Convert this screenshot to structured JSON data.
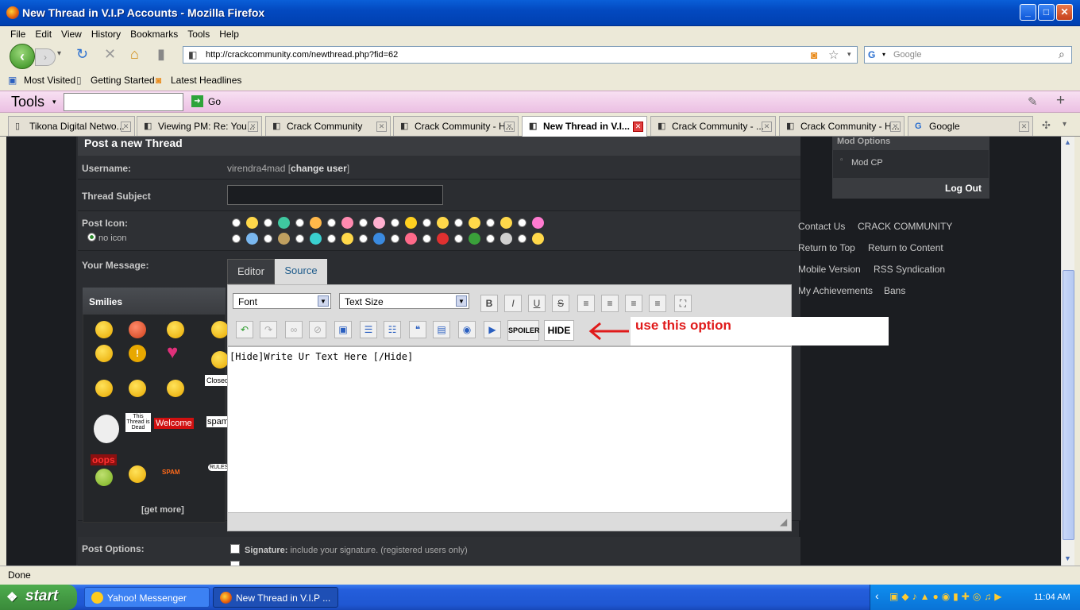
{
  "window": {
    "title": "New Thread in V.I.P Accounts - Mozilla Firefox",
    "min": "_",
    "max": "□",
    "close": "✕"
  },
  "menu": [
    "File",
    "Edit",
    "View",
    "History",
    "Bookmarks",
    "Tools",
    "Help"
  ],
  "nav": {
    "url": "http://crackcommunity.com/newthread.php?fid=62",
    "search_placeholder": "Google"
  },
  "bookmarks": [
    "Most Visited",
    "Getting Started",
    "Latest Headlines"
  ],
  "toolsbar": {
    "label": "Tools",
    "go": "Go"
  },
  "tabs": [
    {
      "label": "Tikona Digital Netwo...",
      "icon": "page-icon"
    },
    {
      "label": "Viewing PM: Re: You...",
      "icon": "cc-icon"
    },
    {
      "label": "Crack Community",
      "icon": "cc-icon"
    },
    {
      "label": "Crack Community - H...",
      "icon": "cc-icon"
    },
    {
      "label": "New Thread in V.I...",
      "icon": "cc-icon",
      "active": true
    },
    {
      "label": "Crack Community - ...",
      "icon": "cc-icon"
    },
    {
      "label": "Crack Community - H...",
      "icon": "cc-icon"
    },
    {
      "label": "Google",
      "icon": "google-icon"
    }
  ],
  "form": {
    "heading": "Post a new Thread",
    "username_label": "Username:",
    "username": "virendra4mad",
    "change_user": "change user",
    "subject_label": "Thread Subject",
    "subject_value": "",
    "post_icon_label": "Post Icon:",
    "no_icon": "no icon",
    "message_label": "Your Message:",
    "post_options_label": "Post Options:",
    "signature_label": "Signature:",
    "signature_text": "include your signature. (registered users only)"
  },
  "editor": {
    "tab_editor": "Editor",
    "tab_source": "Source",
    "font": "Font",
    "size": "Text Size",
    "spoiler": "SPOILER",
    "hide": "HIDE",
    "content": "[Hide]Write Ur Text Here [/Hide]"
  },
  "smilies": {
    "title": "Smilies",
    "get_more": "[get more]",
    "closed": "Closed",
    "dead": "This Thread is Dead",
    "welcome": "Welcome",
    "spam": "spam",
    "oops": "oops",
    "spam2": "SPAM",
    "rules": "RULES"
  },
  "annotation": "use this option",
  "sidebar": {
    "mod_options": "Mod Options",
    "mod_cp": "Mod CP",
    "logout": "Log Out",
    "links": [
      "Contact Us",
      "CRACK COMMUNITY",
      "Return to Top",
      "Return to Content",
      "Mobile Version",
      "RSS Syndication",
      "My Achievements",
      "Bans"
    ]
  },
  "status": "Done",
  "taskbar": {
    "start": "start",
    "tasks": [
      "Yahoo! Messenger",
      "New Thread in V.I.P ..."
    ],
    "clock": "11:04 AM"
  }
}
